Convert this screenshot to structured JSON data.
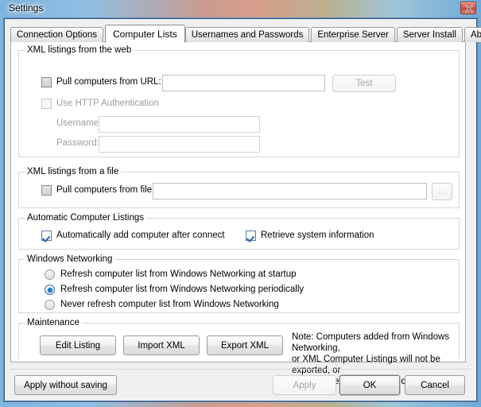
{
  "window": {
    "title": "Settings",
    "close_icon": "close-icon"
  },
  "tabs": [
    {
      "label": "Connection Options",
      "active": false
    },
    {
      "label": "Computer Lists",
      "active": true
    },
    {
      "label": "Usernames and Passwords",
      "active": false
    },
    {
      "label": "Enterprise Server",
      "active": false
    },
    {
      "label": "Server Install",
      "active": false
    },
    {
      "label": "About",
      "active": false
    }
  ],
  "web_group": {
    "legend": "XML listings from the web",
    "pull_url_checkbox_label": "Pull computers from URL:",
    "pull_url_checked": false,
    "url_value": "",
    "test_button": "Test",
    "http_auth_checkbox_label": "Use HTTP Authentication",
    "http_auth_checked": false,
    "username_label": "Username:",
    "username_value": "",
    "password_label": "Password:",
    "password_value": ""
  },
  "file_group": {
    "legend": "XML listings from a file",
    "pull_file_checkbox_label": "Pull computers from file:",
    "pull_file_checked": false,
    "file_value": "",
    "browse_button": "..."
  },
  "auto_group": {
    "legend": "Automatic Computer Listings",
    "auto_add_label": "Automatically add computer after connect",
    "auto_add_checked": true,
    "retrieve_label": "Retrieve system information",
    "retrieve_checked": true
  },
  "networking_group": {
    "legend": "Windows Networking",
    "options": [
      {
        "label": "Refresh computer list from Windows Networking at startup",
        "selected": false
      },
      {
        "label": "Refresh computer list from Windows Networking periodically",
        "selected": true
      },
      {
        "label": "Never refresh computer list from Windows Networking",
        "selected": false
      }
    ]
  },
  "maintenance_group": {
    "legend": "Maintenance",
    "edit_listing_button": "Edit Listing",
    "import_xml_button": "Import XML",
    "export_xml_button": "Export XML",
    "note": "Note: Computers added from Windows Networking,\nor XML Computer Listings will not be exported, or\naltered when an import is completed."
  },
  "footer": {
    "apply_without_saving_button": "Apply without saving",
    "apply_button": "Apply",
    "apply_enabled": false,
    "ok_button": "OK",
    "cancel_button": "Cancel"
  },
  "colors": {
    "accent": "#1a7ec8",
    "check": "#2b5da8",
    "close_red": "#c64734",
    "frame_blue": "#5a87b8"
  }
}
